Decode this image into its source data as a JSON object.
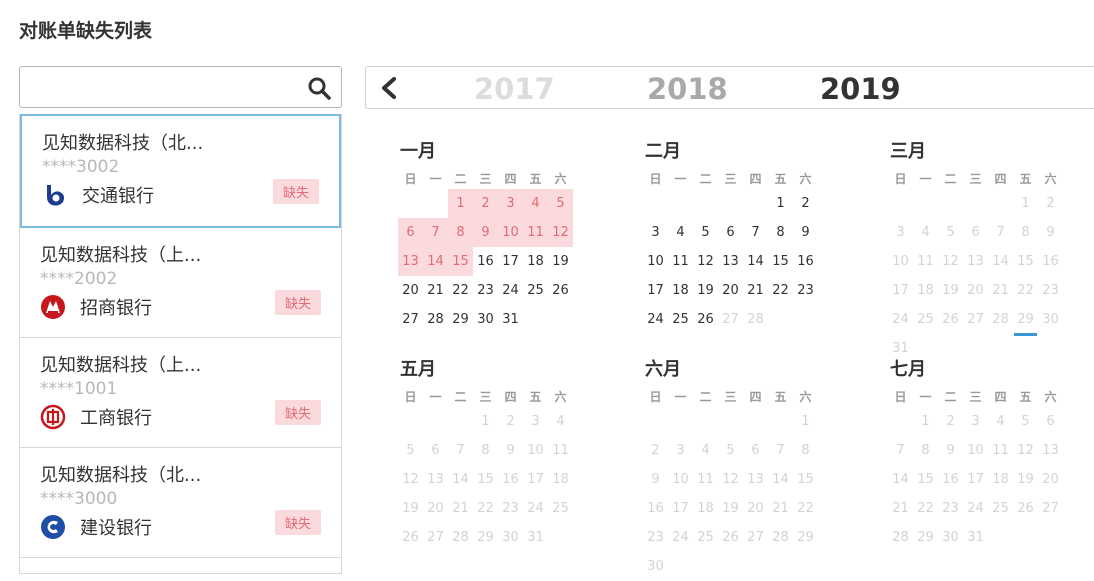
{
  "page": {
    "title": "对账单缺失列表"
  },
  "search": {
    "value": "",
    "placeholder": ""
  },
  "accounts": [
    {
      "company": "见知数据科技（北...",
      "account": "****3002",
      "bank": "交通银行",
      "status": "缺失",
      "logo": "bocom-logo",
      "logo_color": "#1d3c8f"
    },
    {
      "company": "见知数据科技（上...",
      "account": "****2002",
      "bank": "招商银行",
      "status": "缺失",
      "logo": "cmb-logo",
      "logo_color": "#c8161d"
    },
    {
      "company": "见知数据科技（上...",
      "account": "****1001",
      "bank": "工商银行",
      "status": "缺失",
      "logo": "icbc-logo",
      "logo_color": "#c8161d"
    },
    {
      "company": "见知数据科技（北...",
      "account": "****3000",
      "bank": "建设银行",
      "status": "缺失",
      "logo": "ccb-logo",
      "logo_color": "#1f4ea6"
    }
  ],
  "years": {
    "prev": "2017",
    "current": "2018",
    "next": "2019"
  },
  "weekdays": [
    "日",
    "一",
    "二",
    "三",
    "四",
    "五",
    "六"
  ],
  "months": [
    {
      "name": "一月",
      "offset": 2,
      "days": 31,
      "highlight": [
        1,
        2,
        3,
        4,
        5,
        6,
        7,
        8,
        9,
        10,
        11,
        12,
        13,
        14,
        15
      ],
      "dim_from": 32
    },
    {
      "name": "二月",
      "offset": 5,
      "days": 28,
      "highlight": [],
      "dim_from": 27
    },
    {
      "name": "三月",
      "offset": 5,
      "days": 31,
      "highlight": [],
      "dim_from": 1,
      "today": 29
    },
    {
      "name": "五月",
      "offset": 3,
      "days": 31,
      "highlight": [],
      "dim_from": 1
    },
    {
      "name": "六月",
      "offset": 6,
      "days": 30,
      "highlight": [],
      "dim_from": 1
    },
    {
      "name": "七月",
      "offset": 1,
      "days": 31,
      "highlight": [],
      "dim_from": 1
    }
  ],
  "colors": {
    "accent": "#3a97d4",
    "missing_bg": "#fadadd",
    "missing_text": "#e26b76",
    "selected_border": "#7ebbe3"
  }
}
